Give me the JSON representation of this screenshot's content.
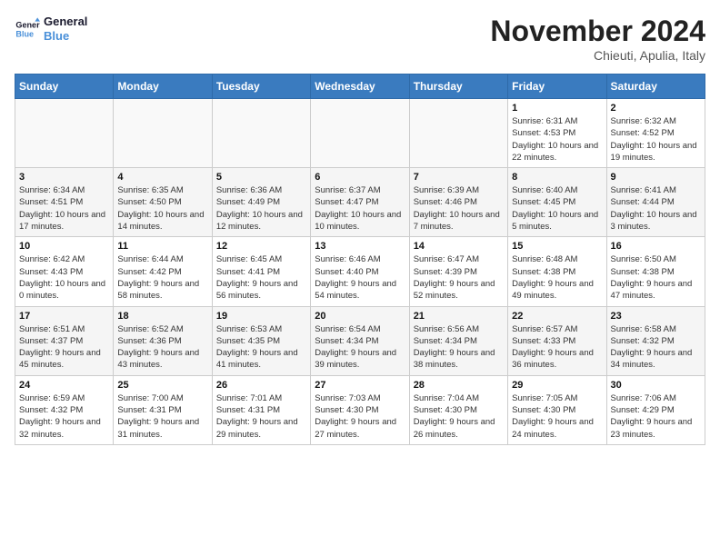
{
  "logo": {
    "line1": "General",
    "line2": "Blue"
  },
  "title": "November 2024",
  "location": "Chieuti, Apulia, Italy",
  "weekdays": [
    "Sunday",
    "Monday",
    "Tuesday",
    "Wednesday",
    "Thursday",
    "Friday",
    "Saturday"
  ],
  "weeks": [
    [
      {
        "day": "",
        "info": ""
      },
      {
        "day": "",
        "info": ""
      },
      {
        "day": "",
        "info": ""
      },
      {
        "day": "",
        "info": ""
      },
      {
        "day": "",
        "info": ""
      },
      {
        "day": "1",
        "info": "Sunrise: 6:31 AM\nSunset: 4:53 PM\nDaylight: 10 hours and 22 minutes."
      },
      {
        "day": "2",
        "info": "Sunrise: 6:32 AM\nSunset: 4:52 PM\nDaylight: 10 hours and 19 minutes."
      }
    ],
    [
      {
        "day": "3",
        "info": "Sunrise: 6:34 AM\nSunset: 4:51 PM\nDaylight: 10 hours and 17 minutes."
      },
      {
        "day": "4",
        "info": "Sunrise: 6:35 AM\nSunset: 4:50 PM\nDaylight: 10 hours and 14 minutes."
      },
      {
        "day": "5",
        "info": "Sunrise: 6:36 AM\nSunset: 4:49 PM\nDaylight: 10 hours and 12 minutes."
      },
      {
        "day": "6",
        "info": "Sunrise: 6:37 AM\nSunset: 4:47 PM\nDaylight: 10 hours and 10 minutes."
      },
      {
        "day": "7",
        "info": "Sunrise: 6:39 AM\nSunset: 4:46 PM\nDaylight: 10 hours and 7 minutes."
      },
      {
        "day": "8",
        "info": "Sunrise: 6:40 AM\nSunset: 4:45 PM\nDaylight: 10 hours and 5 minutes."
      },
      {
        "day": "9",
        "info": "Sunrise: 6:41 AM\nSunset: 4:44 PM\nDaylight: 10 hours and 3 minutes."
      }
    ],
    [
      {
        "day": "10",
        "info": "Sunrise: 6:42 AM\nSunset: 4:43 PM\nDaylight: 10 hours and 0 minutes."
      },
      {
        "day": "11",
        "info": "Sunrise: 6:44 AM\nSunset: 4:42 PM\nDaylight: 9 hours and 58 minutes."
      },
      {
        "day": "12",
        "info": "Sunrise: 6:45 AM\nSunset: 4:41 PM\nDaylight: 9 hours and 56 minutes."
      },
      {
        "day": "13",
        "info": "Sunrise: 6:46 AM\nSunset: 4:40 PM\nDaylight: 9 hours and 54 minutes."
      },
      {
        "day": "14",
        "info": "Sunrise: 6:47 AM\nSunset: 4:39 PM\nDaylight: 9 hours and 52 minutes."
      },
      {
        "day": "15",
        "info": "Sunrise: 6:48 AM\nSunset: 4:38 PM\nDaylight: 9 hours and 49 minutes."
      },
      {
        "day": "16",
        "info": "Sunrise: 6:50 AM\nSunset: 4:38 PM\nDaylight: 9 hours and 47 minutes."
      }
    ],
    [
      {
        "day": "17",
        "info": "Sunrise: 6:51 AM\nSunset: 4:37 PM\nDaylight: 9 hours and 45 minutes."
      },
      {
        "day": "18",
        "info": "Sunrise: 6:52 AM\nSunset: 4:36 PM\nDaylight: 9 hours and 43 minutes."
      },
      {
        "day": "19",
        "info": "Sunrise: 6:53 AM\nSunset: 4:35 PM\nDaylight: 9 hours and 41 minutes."
      },
      {
        "day": "20",
        "info": "Sunrise: 6:54 AM\nSunset: 4:34 PM\nDaylight: 9 hours and 39 minutes."
      },
      {
        "day": "21",
        "info": "Sunrise: 6:56 AM\nSunset: 4:34 PM\nDaylight: 9 hours and 38 minutes."
      },
      {
        "day": "22",
        "info": "Sunrise: 6:57 AM\nSunset: 4:33 PM\nDaylight: 9 hours and 36 minutes."
      },
      {
        "day": "23",
        "info": "Sunrise: 6:58 AM\nSunset: 4:32 PM\nDaylight: 9 hours and 34 minutes."
      }
    ],
    [
      {
        "day": "24",
        "info": "Sunrise: 6:59 AM\nSunset: 4:32 PM\nDaylight: 9 hours and 32 minutes."
      },
      {
        "day": "25",
        "info": "Sunrise: 7:00 AM\nSunset: 4:31 PM\nDaylight: 9 hours and 31 minutes."
      },
      {
        "day": "26",
        "info": "Sunrise: 7:01 AM\nSunset: 4:31 PM\nDaylight: 9 hours and 29 minutes."
      },
      {
        "day": "27",
        "info": "Sunrise: 7:03 AM\nSunset: 4:30 PM\nDaylight: 9 hours and 27 minutes."
      },
      {
        "day": "28",
        "info": "Sunrise: 7:04 AM\nSunset: 4:30 PM\nDaylight: 9 hours and 26 minutes."
      },
      {
        "day": "29",
        "info": "Sunrise: 7:05 AM\nSunset: 4:30 PM\nDaylight: 9 hours and 24 minutes."
      },
      {
        "day": "30",
        "info": "Sunrise: 7:06 AM\nSunset: 4:29 PM\nDaylight: 9 hours and 23 minutes."
      }
    ]
  ]
}
